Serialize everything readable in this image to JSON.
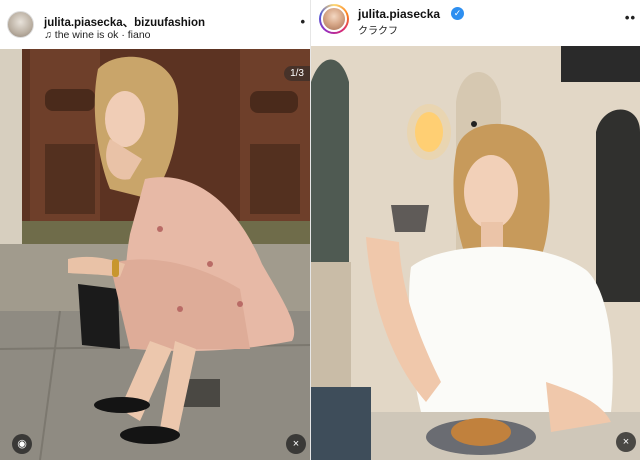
{
  "left_post": {
    "username": "julita.piasecka、bizuufashion",
    "music_icon": "music-note-icon",
    "audio": "the wine is ok · fiano",
    "more_label": "•",
    "counter": "1/3",
    "icons": {
      "user_tag": "user-tag-icon",
      "mute": "muted-speaker-icon"
    },
    "colors": {
      "door": "#5c3322",
      "dress": "#e7b9a6",
      "pavement": "#9e9a91"
    }
  },
  "right_post": {
    "username": "julita.piasecka",
    "verified_icon": "verified-badge-icon",
    "verified_glyph": "✓",
    "location": "クラクフ",
    "more_label": "••",
    "icons": {
      "mute": "muted-speaker-icon"
    },
    "colors": {
      "wall": "#e2d7c6",
      "shirt": "#fbfbf8",
      "lamp": "#ffcf73",
      "story_ring": "#d62976",
      "verified": "#2e8ff0"
    }
  }
}
